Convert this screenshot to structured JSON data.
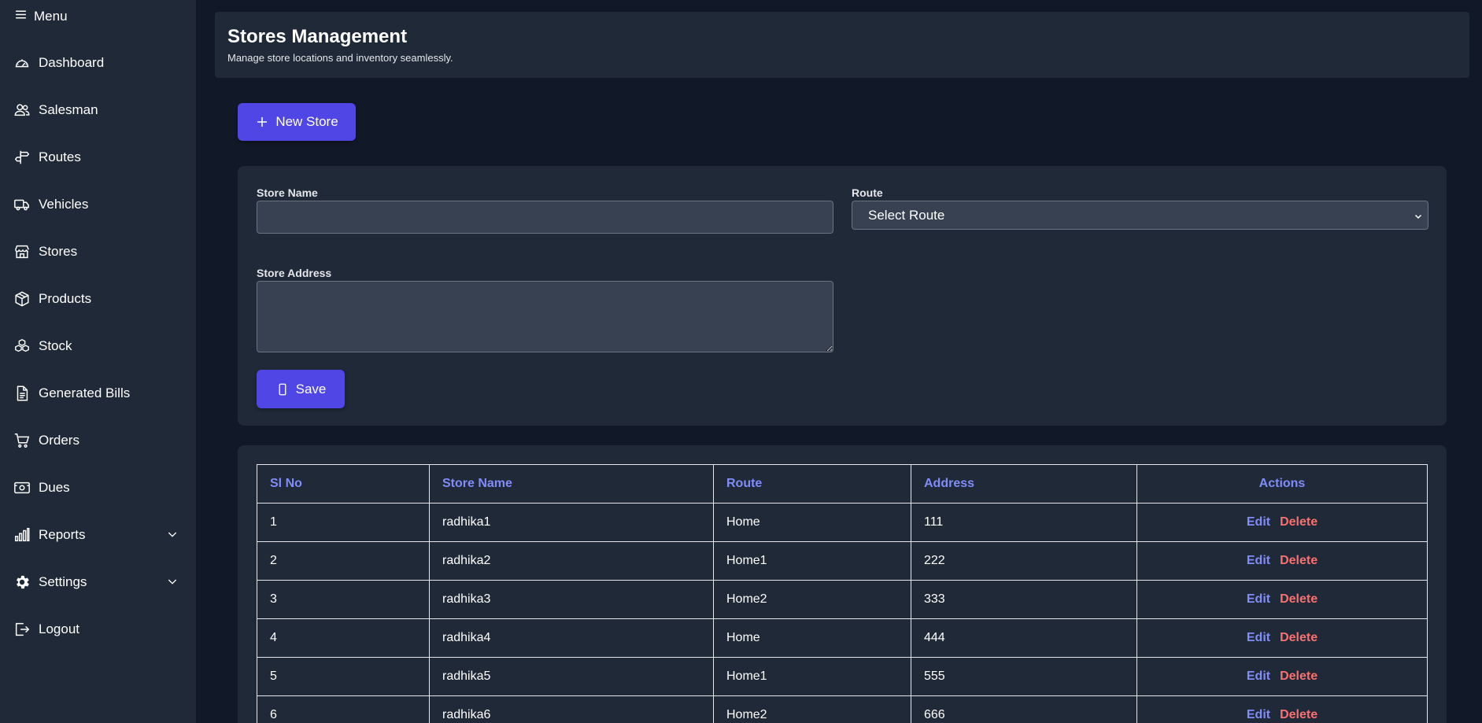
{
  "sidebar": {
    "menu_label": "Menu",
    "items": [
      {
        "label": "Dashboard",
        "icon": "gauge-icon"
      },
      {
        "label": "Salesman",
        "icon": "users-icon"
      },
      {
        "label": "Routes",
        "icon": "signpost-icon"
      },
      {
        "label": "Vehicles",
        "icon": "truck-icon"
      },
      {
        "label": "Stores",
        "icon": "store-icon"
      },
      {
        "label": "Products",
        "icon": "box-icon"
      },
      {
        "label": "Stock",
        "icon": "boxes-icon"
      },
      {
        "label": "Generated Bills",
        "icon": "file-icon"
      },
      {
        "label": "Orders",
        "icon": "cart-icon"
      },
      {
        "label": "Dues",
        "icon": "cash-icon"
      },
      {
        "label": "Reports",
        "icon": "bar-chart-icon"
      },
      {
        "label": "Settings",
        "icon": "gear-icon"
      },
      {
        "label": "Logout",
        "icon": "logout-icon"
      }
    ]
  },
  "header": {
    "title": "Stores Management",
    "subtitle": "Manage store locations and inventory seamlessly."
  },
  "new_store_label": "New Store",
  "form": {
    "store_name_label": "Store Name",
    "store_name_value": "",
    "route_label": "Route",
    "route_selected": "Select Route",
    "address_label": "Store Address",
    "address_value": "",
    "save_label": "Save"
  },
  "table": {
    "headers": [
      "Sl No",
      "Store Name",
      "Route",
      "Address",
      "Actions"
    ],
    "edit_label": "Edit",
    "delete_label": "Delete",
    "rows": [
      {
        "sl": "1",
        "name": "radhika1",
        "route": "Home",
        "address": "111"
      },
      {
        "sl": "2",
        "name": "radhika2",
        "route": "Home1",
        "address": "222"
      },
      {
        "sl": "3",
        "name": "radhika3",
        "route": "Home2",
        "address": "333"
      },
      {
        "sl": "4",
        "name": "radhika4",
        "route": "Home",
        "address": "444"
      },
      {
        "sl": "5",
        "name": "radhika5",
        "route": "Home1",
        "address": "555"
      },
      {
        "sl": "6",
        "name": "radhika6",
        "route": "Home2",
        "address": "666"
      }
    ]
  },
  "colors": {
    "background": "#111827",
    "panel": "#1f2937",
    "accent": "#4f46e5",
    "header_text": "#818cf8",
    "delete": "#f87171"
  }
}
